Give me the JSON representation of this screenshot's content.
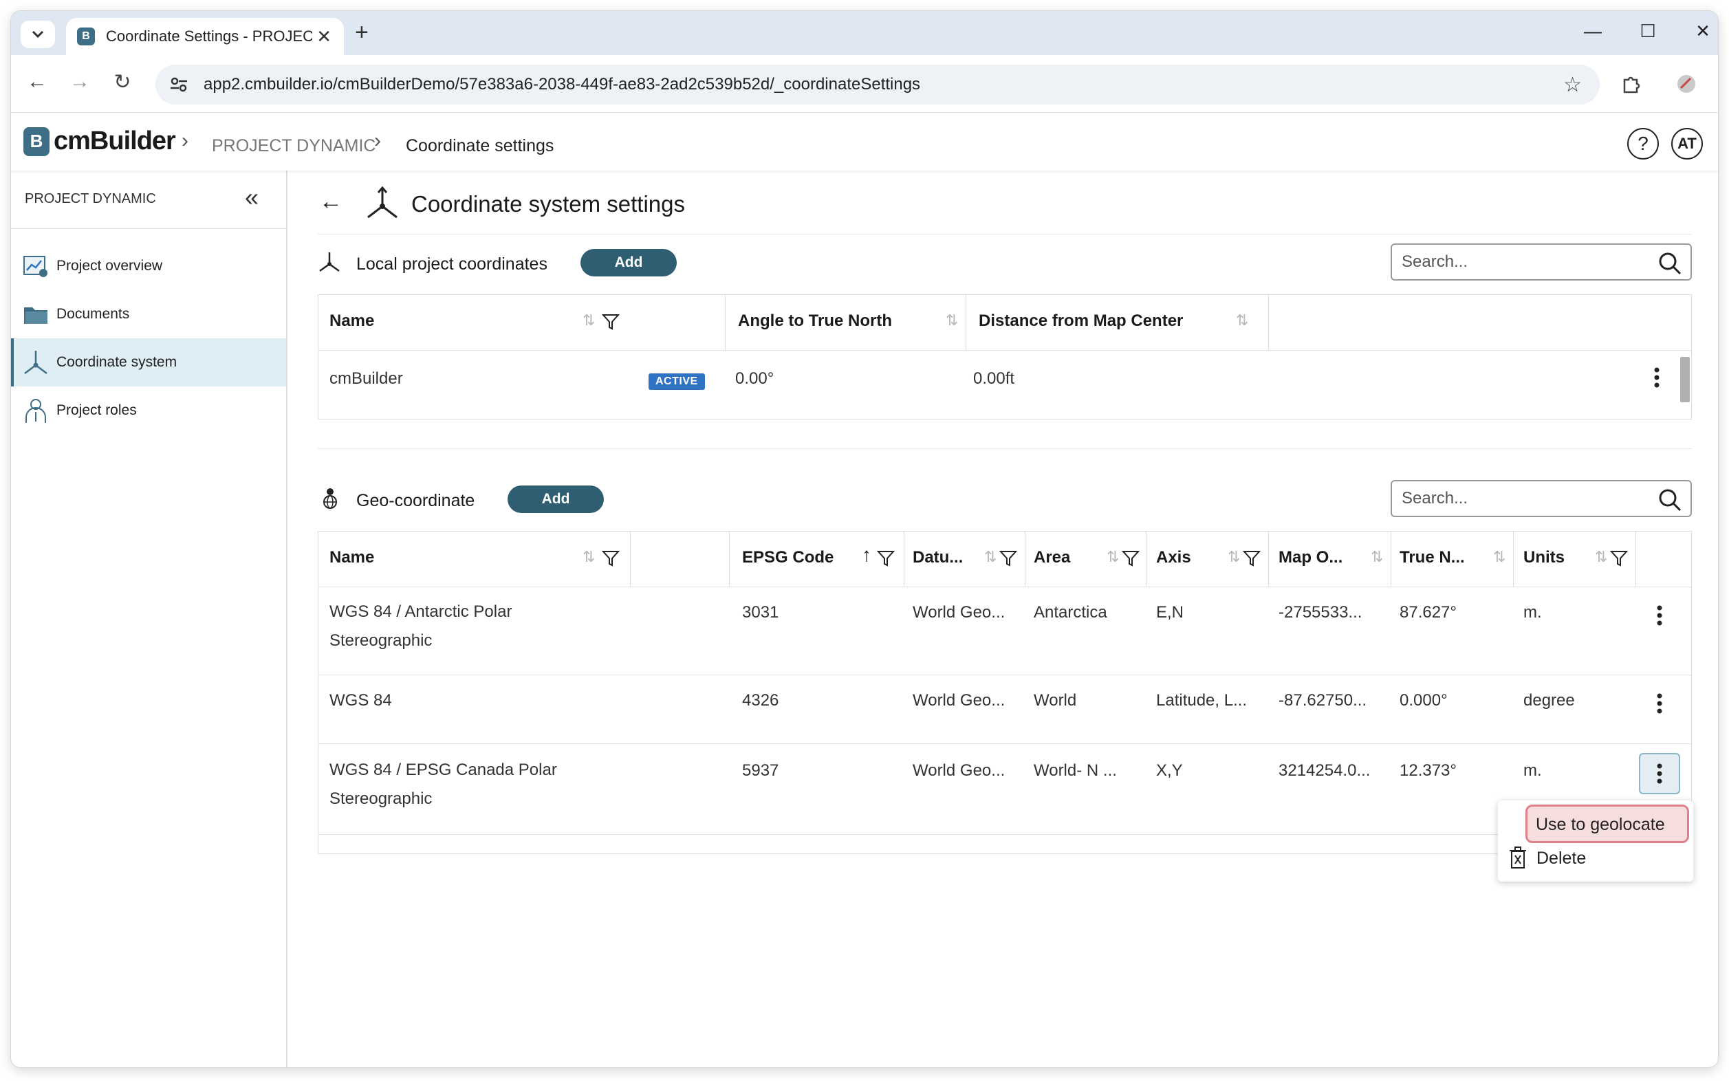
{
  "browser": {
    "tab_title": "Coordinate Settings - PROJECT",
    "url": "app2.cmbuilder.io/cmBuilderDemo/57e383a6-2038-449f-ae83-2ad2c539b52d/_coordinateSettings"
  },
  "app": {
    "logo_text": "cmBuilder",
    "logo_badge": "B",
    "breadcrumb": [
      "PROJECT DYNAMIC",
      "Coordinate settings"
    ],
    "help_label": "?",
    "avatar_initials": "AT"
  },
  "sidebar": {
    "header": "PROJECT DYNAMIC",
    "items": [
      {
        "label": "Project overview",
        "icon": "project-overview-icon",
        "active": false
      },
      {
        "label": "Documents",
        "icon": "folder-icon",
        "active": false
      },
      {
        "label": "Coordinate system",
        "icon": "coordinate-axes-icon",
        "active": true
      },
      {
        "label": "Project roles",
        "icon": "user-roles-icon",
        "active": false
      }
    ]
  },
  "page": {
    "title": "Coordinate system settings"
  },
  "local": {
    "label": "Local project coordinates",
    "add_label": "Add",
    "search_placeholder": "Search...",
    "columns": [
      "Name",
      "Angle to True North",
      "Distance from Map Center"
    ],
    "rows": [
      {
        "name": "cmBuilder",
        "badge": "ACTIVE",
        "angle": "0.00°",
        "distance": "0.00ft"
      }
    ]
  },
  "geo": {
    "label": "Geo-coordinate",
    "add_label": "Add",
    "search_placeholder": "Search...",
    "columns": [
      "Name",
      "EPSG Code",
      "Datu...",
      "Area",
      "Axis",
      "Map O...",
      "True N...",
      "Units"
    ],
    "rows": [
      {
        "name": "WGS 84 / Antarctic Polar Stereographic",
        "epsg": "3031",
        "datum": "World Geo...",
        "area": "Antarctica",
        "axis": "E,N",
        "map_origin": "-2755533...",
        "true_north": "87.627°",
        "units": "m."
      },
      {
        "name": "WGS 84",
        "epsg": "4326",
        "datum": "World Geo...",
        "area": "World",
        "axis": "Latitude, L...",
        "map_origin": "-87.62750...",
        "true_north": "0.000°",
        "units": "degree"
      },
      {
        "name": "WGS 84 / EPSG Canada Polar Stereographic",
        "epsg": "5937",
        "datum": "World Geo...",
        "area": "World- N ...",
        "axis": "X,Y",
        "map_origin": "3214254.0...",
        "true_north": "12.373°",
        "units": "m."
      }
    ]
  },
  "context_menu": {
    "items": [
      "Use to geolocate",
      "Delete"
    ]
  },
  "colors": {
    "accent": "#2f5e72",
    "brand": "#3e6e85",
    "active_badge": "#2f73c4",
    "highlight_border": "#e0808a"
  }
}
